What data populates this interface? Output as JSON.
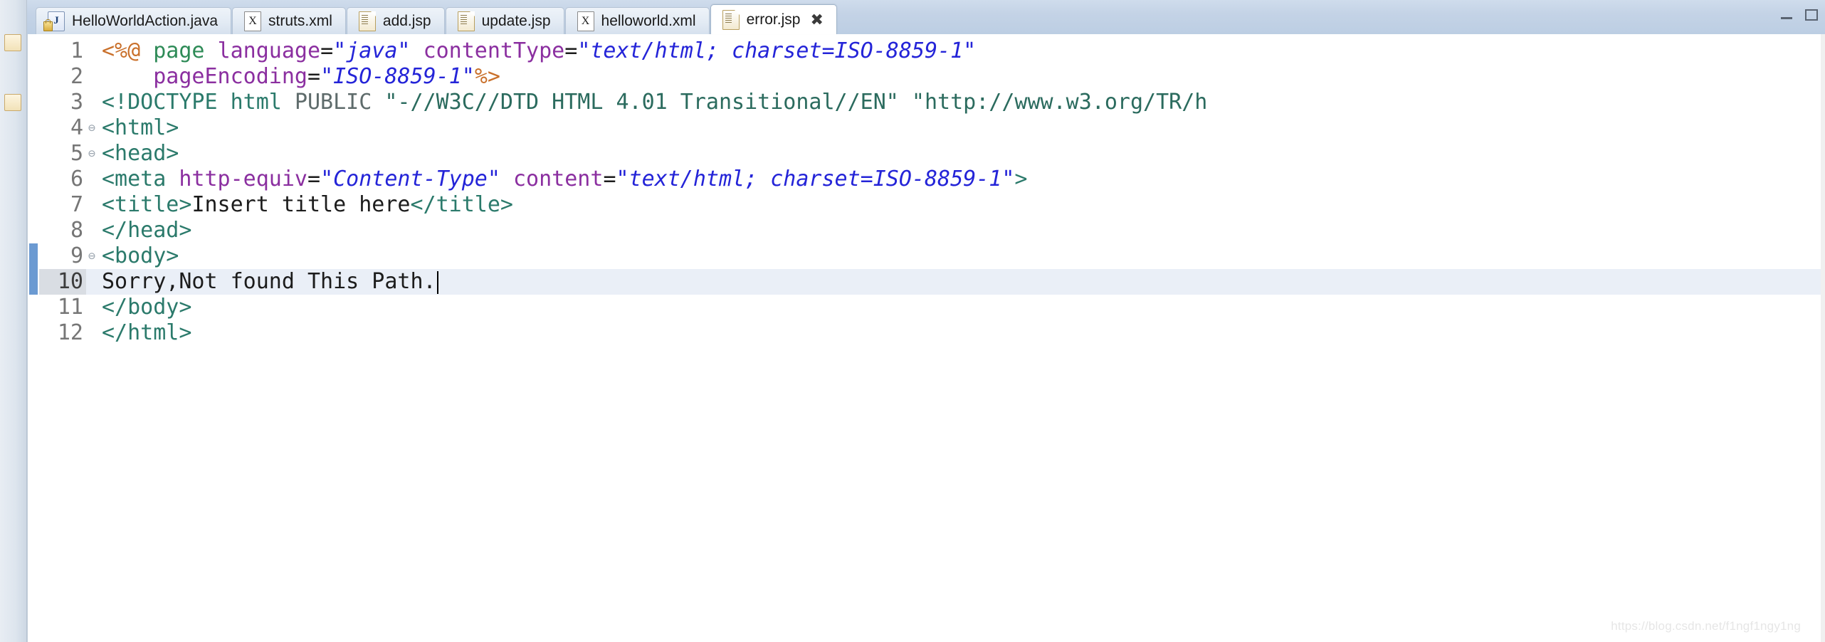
{
  "window": {
    "minimize_label": "—",
    "maximize_label": "▢"
  },
  "tabs": [
    {
      "label": "HelloWorldAction.java",
      "icon": "java-file-icon",
      "active": false,
      "closable": false
    },
    {
      "label": "struts.xml",
      "icon": "xml-file-icon",
      "active": false,
      "closable": false
    },
    {
      "label": "add.jsp",
      "icon": "jsp-file-icon",
      "active": false,
      "closable": false
    },
    {
      "label": "update.jsp",
      "icon": "jsp-file-icon",
      "active": false,
      "closable": false
    },
    {
      "label": "helloworld.xml",
      "icon": "xml-file-icon",
      "active": false,
      "closable": false
    },
    {
      "label": "error.jsp",
      "icon": "jsp-file-icon",
      "active": true,
      "closable": true,
      "close_label": "✖"
    }
  ],
  "editor": {
    "active_file": "error.jsp",
    "current_line": 10,
    "caret_line": 10,
    "lines": [
      {
        "number": "1",
        "fold": "",
        "tokens": [
          {
            "text": "<%@",
            "type": "dir"
          },
          {
            "text": " ",
            "type": "plain"
          },
          {
            "text": "page",
            "type": "kw"
          },
          {
            "text": " ",
            "type": "plain"
          },
          {
            "text": "language",
            "type": "attr"
          },
          {
            "text": "=",
            "type": "eq"
          },
          {
            "text": "\"java\"",
            "type": "str"
          },
          {
            "text": " ",
            "type": "plain"
          },
          {
            "text": "contentType",
            "type": "attr"
          },
          {
            "text": "=",
            "type": "eq"
          },
          {
            "text": "\"text/html; charset=ISO-8859-1\"",
            "type": "str"
          }
        ]
      },
      {
        "number": "2",
        "fold": "",
        "tokens": [
          {
            "text": "    ",
            "type": "plain"
          },
          {
            "text": "pageEncoding",
            "type": "attr"
          },
          {
            "text": "=",
            "type": "eq"
          },
          {
            "text": "\"ISO-8859-1\"",
            "type": "str"
          },
          {
            "text": "%>",
            "type": "dir"
          }
        ]
      },
      {
        "number": "3",
        "fold": "",
        "tokens": [
          {
            "text": "<!DOCTYPE",
            "type": "doctype"
          },
          {
            "text": " ",
            "type": "plain"
          },
          {
            "text": "html",
            "type": "tag"
          },
          {
            "text": " ",
            "type": "plain"
          },
          {
            "text": "PUBLIC",
            "type": "gray"
          },
          {
            "text": " ",
            "type": "plain"
          },
          {
            "text": "\"-//W3C//DTD HTML 4.01 Transitional//EN\"",
            "type": "dt-str"
          },
          {
            "text": " ",
            "type": "plain"
          },
          {
            "text": "\"http://www.w3.org/TR/h",
            "type": "dt-str"
          }
        ]
      },
      {
        "number": "4",
        "fold": "⊖",
        "tokens": [
          {
            "text": "<html>",
            "type": "tag"
          }
        ]
      },
      {
        "number": "5",
        "fold": "⊖",
        "tokens": [
          {
            "text": "<head>",
            "type": "tag"
          }
        ]
      },
      {
        "number": "6",
        "fold": "",
        "tokens": [
          {
            "text": "<meta",
            "type": "tag"
          },
          {
            "text": " ",
            "type": "plain"
          },
          {
            "text": "http-equiv",
            "type": "attr"
          },
          {
            "text": "=",
            "type": "eq"
          },
          {
            "text": "\"Content-Type\"",
            "type": "str"
          },
          {
            "text": " ",
            "type": "plain"
          },
          {
            "text": "content",
            "type": "attr"
          },
          {
            "text": "=",
            "type": "eq"
          },
          {
            "text": "\"text/html; charset=ISO-8859-1\"",
            "type": "str"
          },
          {
            "text": ">",
            "type": "tag"
          }
        ]
      },
      {
        "number": "7",
        "fold": "",
        "tokens": [
          {
            "text": "<title>",
            "type": "tag"
          },
          {
            "text": "Insert title here",
            "type": "plain"
          },
          {
            "text": "</title>",
            "type": "tag"
          }
        ]
      },
      {
        "number": "8",
        "fold": "",
        "tokens": [
          {
            "text": "</head>",
            "type": "tag"
          }
        ]
      },
      {
        "number": "9",
        "fold": "⊖",
        "tokens": [
          {
            "text": "<body>",
            "type": "tag"
          }
        ]
      },
      {
        "number": "10",
        "fold": "",
        "current": true,
        "caret_after": true,
        "tokens": [
          {
            "text": "Sorry,Not found This Path.",
            "type": "plain"
          }
        ]
      },
      {
        "number": "11",
        "fold": "",
        "tokens": [
          {
            "text": "</body>",
            "type": "tag"
          }
        ]
      },
      {
        "number": "12",
        "fold": "",
        "tokens": [
          {
            "text": "</html>",
            "type": "tag"
          }
        ]
      }
    ]
  },
  "watermark": {
    "text": "https://blog.csdn.net/f1ngf1ngy1ng"
  },
  "colors": {
    "directive": "#c9702b",
    "keyword": "#2e8b57",
    "attribute": "#8b2fa0",
    "string": "#2424d8",
    "tag": "#2b7a6b",
    "plain": "#1c1c1c",
    "current_line_bg": "#eaeff7",
    "change_bar": "#6b9ad2",
    "tabbar_bg": "#c4d3e6"
  }
}
